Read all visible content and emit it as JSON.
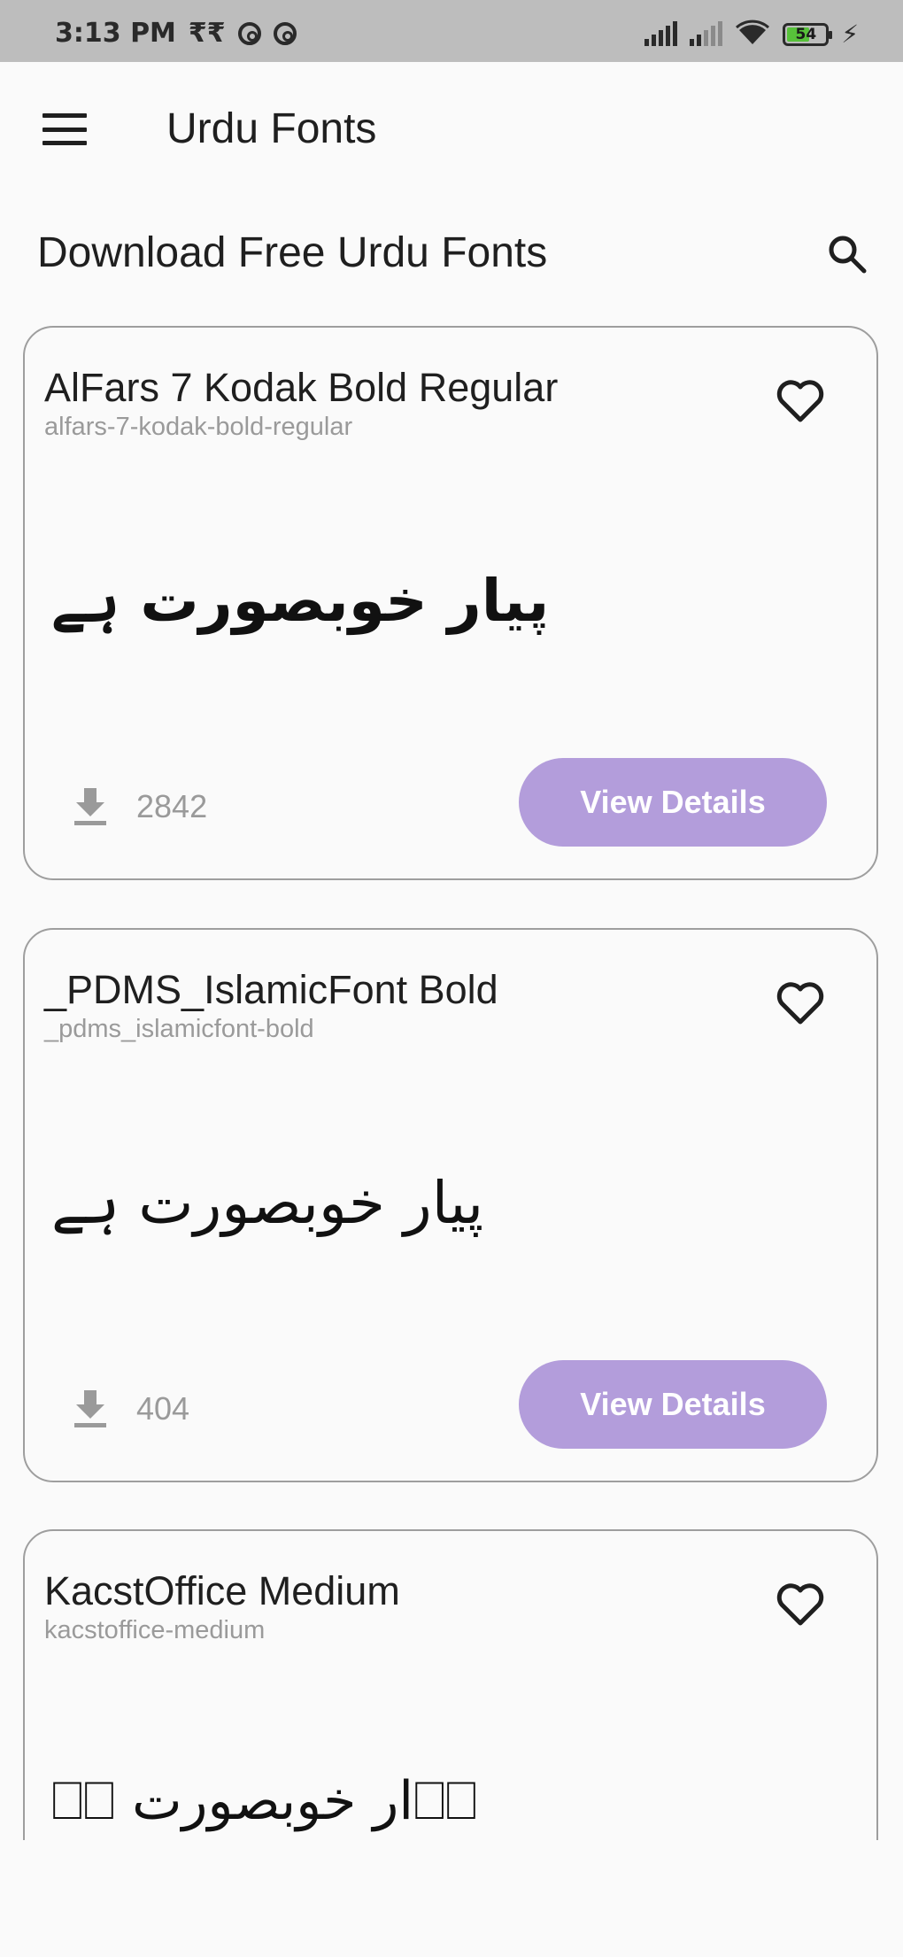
{
  "status_bar": {
    "time": "3:13 PM",
    "carrier_glyph": "₹₹",
    "battery_level": "54",
    "icons": [
      "data-saver-icon",
      "data-saver-icon",
      "signal-icon",
      "signal-weak-icon",
      "wifi-icon",
      "battery-icon",
      "charging-icon"
    ]
  },
  "app_bar": {
    "title": "Urdu Fonts",
    "menu_icon": "hamburger-menu-icon"
  },
  "section": {
    "heading": "Download Free Urdu Fonts",
    "search_icon": "search-icon"
  },
  "cards": [
    {
      "title": "AlFars 7 Kodak Bold Regular",
      "slug": "alfars-7-kodak-bold-regular",
      "preview": "پیار خوبصورت ہے",
      "downloads": "2842",
      "button": "View Details"
    },
    {
      "title": "_PDMS_IslamicFont Bold",
      "slug": "_pdms_islamicfont-bold",
      "preview": "پیار خوبصورت ہے",
      "downloads": "404",
      "button": "View Details"
    },
    {
      "title": "KacstOffice Medium",
      "slug": "kacstoffice-medium",
      "preview": "⎕⎕ار خوبصورت ⎕⎕",
      "downloads": "",
      "button": ""
    }
  ],
  "colors": {
    "status_bar_bg": "#bdbdbd",
    "page_bg": "#fafafa",
    "button_bg": "#b39ddb",
    "card_border": "#9e9e9e",
    "muted_text": "#9a9a9a"
  }
}
